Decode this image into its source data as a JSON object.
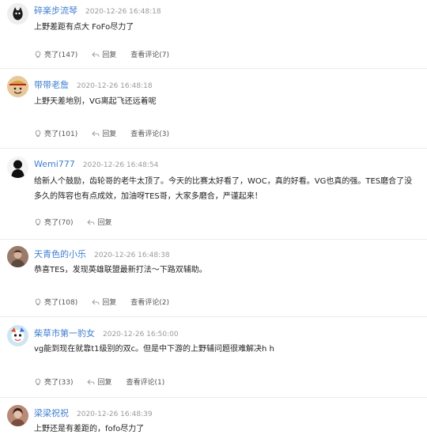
{
  "comments": [
    {
      "username": "碎楽步流琴",
      "time": "2020-12-26 16:48:18",
      "text": "上野差距有点大 FoFo尽力了",
      "like": "亮了(147)",
      "reply": "回复",
      "view": "查看评论(7)",
      "avatar_icon": "black-cat-avatar-icon"
    },
    {
      "username": "带带老詹",
      "time": "2020-12-26 16:48:18",
      "text": "上野天差地别，VG离起飞还远着呢",
      "like": "亮了(101)",
      "reply": "回复",
      "view": "查看评论(3)",
      "avatar_icon": "anime-pirate-avatar-icon"
    },
    {
      "username": "Wemi777",
      "time": "2020-12-26 16:48:54",
      "text": "给新人个鼓励，齿轮哥的老牛太顶了。今天的比赛太好看了，WOC，真的好看。VG也真的强。TES磨合了没多久的阵容也有点成效，加油呀TES哥，大家多磨合，严谨起来！",
      "like": "亮了(70)",
      "reply": "回复",
      "view": "",
      "avatar_icon": "dark-figure-avatar-icon"
    },
    {
      "username": "天青色的小乐",
      "time": "2020-12-26 16:48:38",
      "text": "恭喜TES，发现英雄联盟最新打法～下路双辅助。",
      "like": "亮了(108)",
      "reply": "回复",
      "view": "查看评论(2)",
      "avatar_icon": "photo-avatar-icon"
    },
    {
      "username": "柴草市第一豹女",
      "time": "2020-12-26 16:50:00",
      "text": "vg能到现在就靠t1级别的双c。但是中下游的上野辅问题很难解决h h",
      "like": "亮了(33)",
      "reply": "回复",
      "view": "查看评论(1)",
      "avatar_icon": "cartoon-character-avatar-icon"
    },
    {
      "username": "梁梁祝祝",
      "time": "2020-12-26 16:48:39",
      "text": "上野还是有差距的，fofo尽力了",
      "like": "",
      "reply": "",
      "view": "",
      "avatar_icon": "photo-avatar-icon"
    }
  ],
  "colors": {
    "username": "#3f7fd1",
    "time": "#9a9a9a",
    "divider": "#ececec",
    "text": "#222222",
    "action": "#555555"
  }
}
